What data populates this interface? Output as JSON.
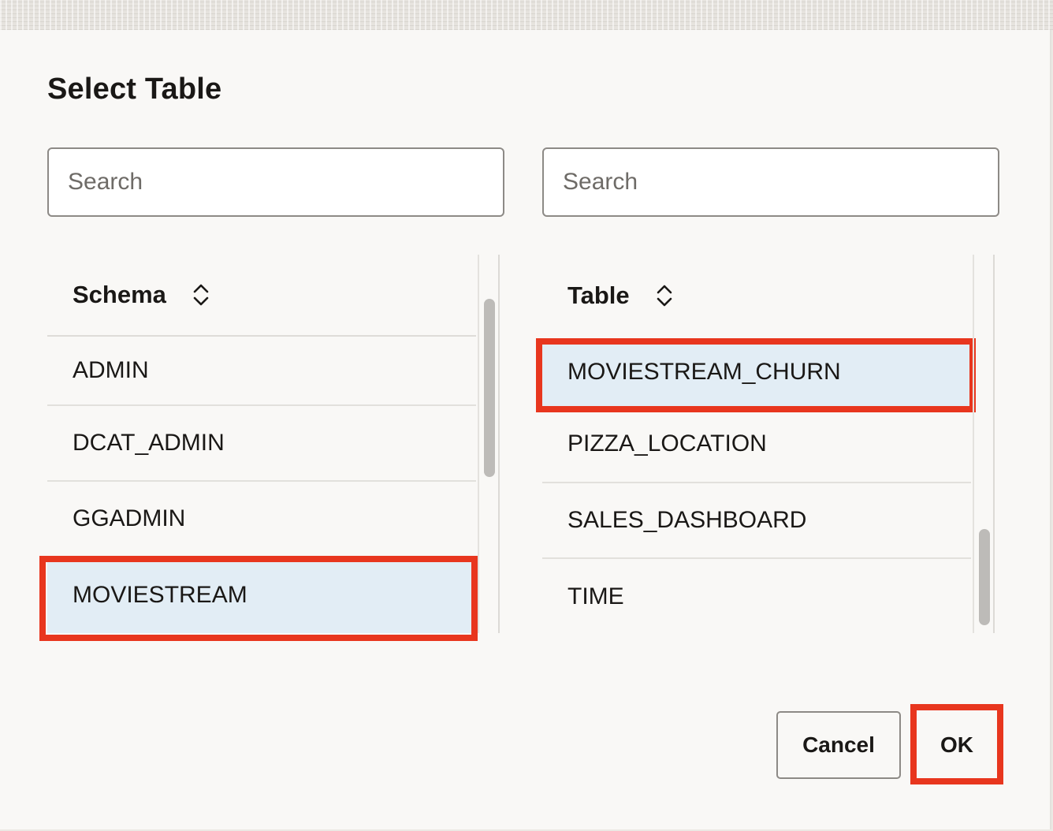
{
  "dialog": {
    "title": "Select Table"
  },
  "schema_panel": {
    "search_placeholder": "Search",
    "header": "Schema",
    "items": [
      "ADMIN",
      "DCAT_ADMIN",
      "GGADMIN",
      "MOVIESTREAM"
    ],
    "selected": "MOVIESTREAM"
  },
  "table_panel": {
    "search_placeholder": "Search",
    "header": "Table",
    "items": [
      "MOVIESTREAM_CHURN",
      "PIZZA_LOCATION",
      "SALES_DASHBOARD",
      "TIME"
    ],
    "selected": "MOVIESTREAM_CHURN"
  },
  "buttons": {
    "cancel": "Cancel",
    "ok": "OK"
  },
  "colors": {
    "highlight": "#e8361e",
    "selected_row": "#e2edf5",
    "scroll_thumb": "#bdbbb8"
  },
  "icons": {
    "sort": "sort-up-down-icon"
  }
}
